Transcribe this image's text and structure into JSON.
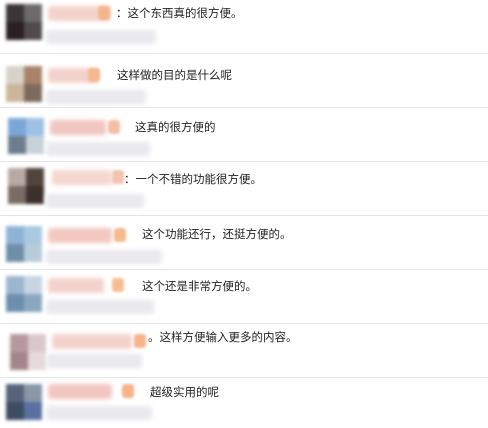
{
  "comments": [
    {
      "text": "：这个东西真的很方便。",
      "avatar_colors": [
        "#3a3538",
        "#6e6a6c",
        "#2a1f22",
        "#504a4d"
      ],
      "accent": "#f6b48a"
    },
    {
      "text": "这样做的目的是什么呢",
      "avatar_colors": [
        "#d9d2c8",
        "#a8836a",
        "#cdb59c",
        "#7d6a5c"
      ],
      "accent": "#f5b88d"
    },
    {
      "text": "这真的很方便的",
      "avatar_colors": [
        "#7aa7d9",
        "#9ec0e4",
        "#6c7e8e",
        "#c7d2d9"
      ],
      "accent": "#f3c0a6"
    },
    {
      "text": "：一个不错的功能很方便。",
      "avatar_colors": [
        "#b8a9a3",
        "#52433e",
        "#7a6b64",
        "#3c302c"
      ],
      "accent": "#f2c3b0"
    },
    {
      "text": "这个功能还行，还挺方便的。",
      "avatar_colors": [
        "#8fb3d6",
        "#a9c9e2",
        "#6f8fa9",
        "#b7cbd9"
      ],
      "accent": "#f4b98e"
    },
    {
      "text": "这个还是非常方便的。",
      "avatar_colors": [
        "#9bb7cf",
        "#c6d6e2",
        "#6d8fae",
        "#8aa7c0"
      ],
      "accent": "#f6bd93"
    },
    {
      "text": "。这样方便输入更多的内容。",
      "avatar_colors": [
        "#b49aa0",
        "#d9c9cc",
        "#a3868c",
        "#e4dadb"
      ],
      "accent": "#f7b489"
    },
    {
      "text": "超级实用的呢",
      "avatar_colors": [
        "#55647a",
        "#8a97a8",
        "#3e4c63",
        "#5a70a0"
      ],
      "accent": "#f6b48a"
    }
  ]
}
